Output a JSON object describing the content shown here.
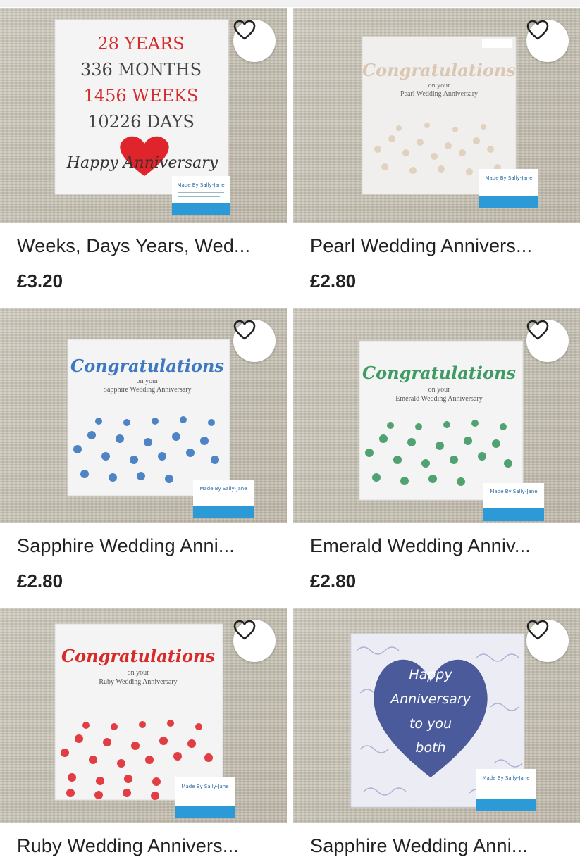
{
  "listings": [
    {
      "title": "Weeks, Days Years, Wed...",
      "price": "£3.20",
      "card_lines": [
        "28 YEARS",
        "336 MONTHS",
        "1456 WEEKS",
        "10226 DAYS"
      ],
      "card_script": "Happy Anniversary",
      "accent": "#d62b2b"
    },
    {
      "title": "Pearl Wedding Annivers...",
      "price": "£2.80",
      "card_heading": "Congratulations",
      "card_sub1": "on your",
      "card_sub2": "Pearl Wedding Anniversary",
      "accent": "#d9c7b3"
    },
    {
      "title": "Sapphire Wedding Anni...",
      "price": "£2.80",
      "card_heading": "Congratulations",
      "card_sub1": "on your",
      "card_sub2": "Sapphire Wedding Anniversary",
      "accent": "#3d78c0"
    },
    {
      "title": "Emerald Wedding Anniv...",
      "price": "£2.80",
      "card_heading": "Congratulations",
      "card_sub1": "on your",
      "card_sub2": "Emerald Wedding Anniversary",
      "accent": "#3f9a63"
    },
    {
      "title": "Ruby Wedding Annivers...",
      "price": "",
      "card_heading": "Congratulations",
      "card_sub1": "on your",
      "card_sub2": "Ruby Wedding Anniversary",
      "accent": "#d92a2a"
    },
    {
      "title": "Sapphire Wedding Anni...",
      "price": "",
      "card_heart_lines": [
        "Happy",
        "Anniversary",
        "to you",
        "both"
      ],
      "accent": "#4a5a9a"
    }
  ],
  "tag_text": "Made By Sally-Jane",
  "favorite_icon": "heart-outline-icon"
}
